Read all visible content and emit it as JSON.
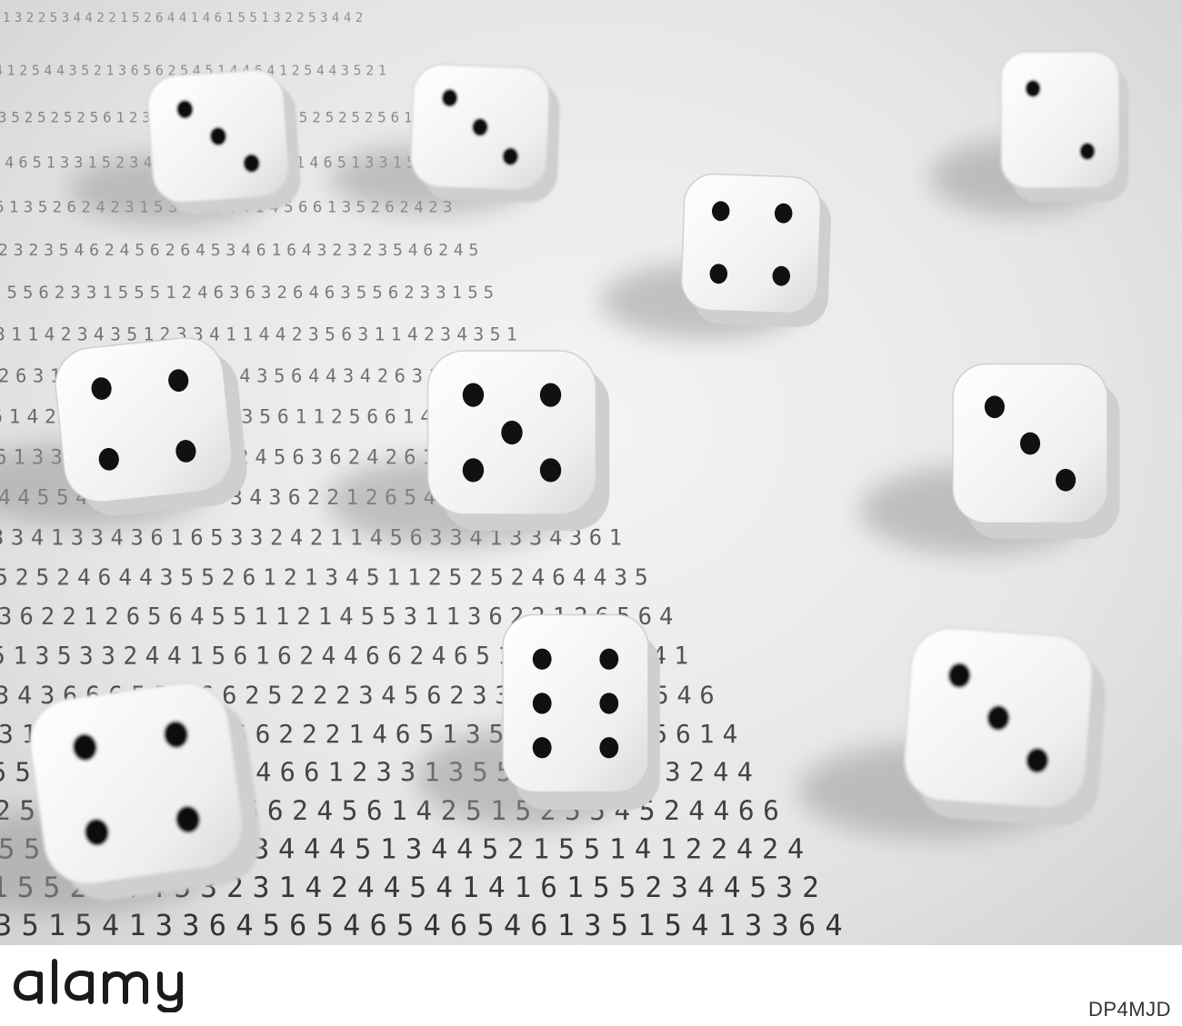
{
  "photo": {
    "subject": "dice-on-random-digit-sheet",
    "digit_rows": [
      "5132253442215264414615",
      "4125443521365625451446",
      "3525252561233553354634",
      "1465133152341362545425",
      "6135262423153621441456",
      "2323546245626453461643",
      "3556233155512463632646",
      "3114234351233411442356",
      "2631441525434543564434",
      "6142135631355235611256",
      "6133444155214245636242",
      "4455434345633436221265",
      "3341334361653324211456",
      "5252464435526121345112",
      "3622126564551121455311",
      "5135332441561624466246",
      "3436665546625222345623",
      "3122235614662221465135",
      "5512433244646612331355",
      "2554524466662456142515",
      "5514122424344451344521",
      "1552344532314244541416",
      "3515413364565465465461"
    ],
    "dice_faces": [
      3,
      3,
      2,
      4,
      4,
      5,
      3,
      4,
      6,
      3
    ],
    "colors": {
      "paper": "#eeeeee",
      "digits": "#2b2b2b",
      "die_body": "#f7f7f7",
      "pip": "#111111",
      "shadow": "#9a9a9a"
    }
  },
  "watermark": {
    "brand": "alamy",
    "icon": "alamy-logo-icon",
    "image_id": "DP4MJD"
  }
}
